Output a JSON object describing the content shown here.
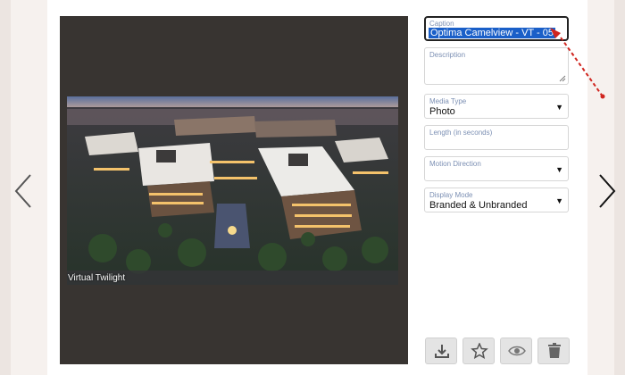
{
  "editor": {
    "photo_label": "Virtual Twilight",
    "caption": {
      "label": "Caption",
      "value": "Optima Camelview - VT - 05"
    },
    "description": {
      "label": "Description",
      "value": ""
    },
    "media_type": {
      "label": "Media Type",
      "value": "Photo"
    },
    "length": {
      "label": "Length (in seconds)",
      "value": ""
    },
    "motion_direction": {
      "label": "Motion Direction",
      "value": ""
    },
    "display_mode": {
      "label": "Display Mode",
      "value": "Branded & Unbranded"
    }
  },
  "icons": {
    "prev": "chevron-left-icon",
    "next": "chevron-right-icon",
    "download": "download-icon",
    "favorite": "star-icon",
    "preview": "eye-icon",
    "delete": "trash-icon"
  },
  "colors": {
    "selection": "#1a5fc8",
    "annotation": "#d0251f",
    "viewer_bg": "#383431"
  }
}
